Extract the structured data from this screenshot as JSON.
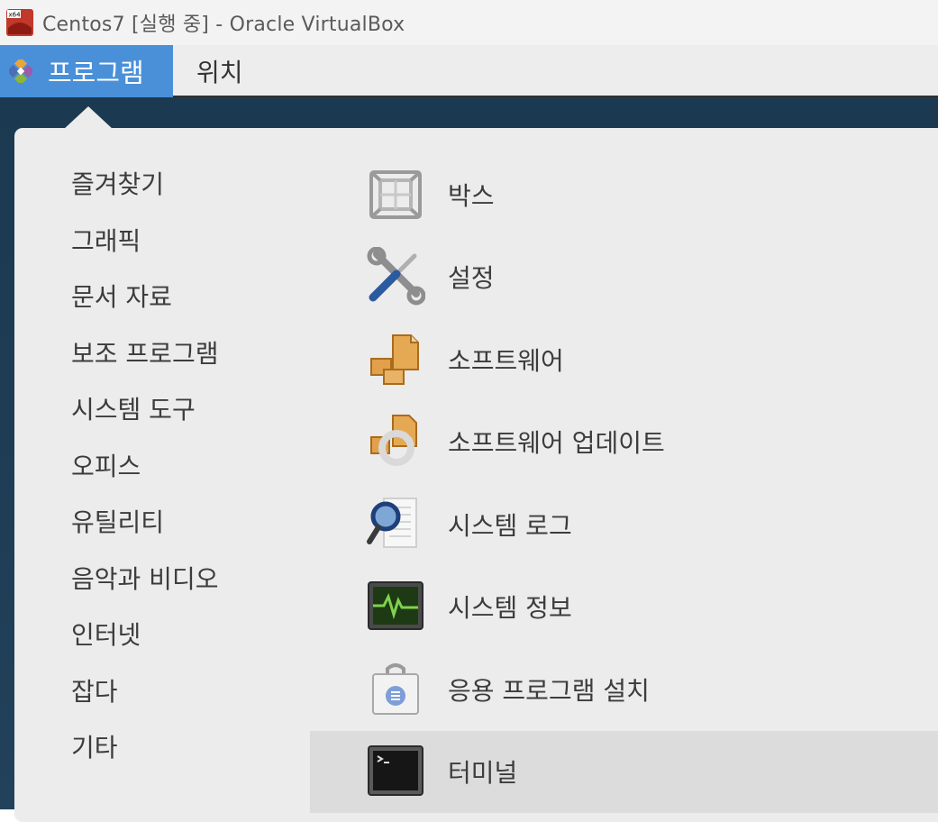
{
  "window": {
    "title": "Centos7 [실행 중] - Oracle VirtualBox",
    "icon": "virtualbox-x64-icon"
  },
  "topbar": {
    "applications_label": "프로그램",
    "places_label": "위치",
    "accent_color": "#4a90d9"
  },
  "categories": [
    {
      "label": "즐겨찾기"
    },
    {
      "label": "그래픽"
    },
    {
      "label": "문서 자료"
    },
    {
      "label": "보조 프로그램"
    },
    {
      "label": "시스템 도구"
    },
    {
      "label": "오피스"
    },
    {
      "label": "유틸리티"
    },
    {
      "label": "음악과 비디오"
    },
    {
      "label": "인터넷"
    },
    {
      "label": "잡다"
    },
    {
      "label": "기타"
    }
  ],
  "apps": [
    {
      "label": "박스",
      "icon": "boxes-icon"
    },
    {
      "label": "설정",
      "icon": "settings-tools-icon"
    },
    {
      "label": "소프트웨어",
      "icon": "software-packages-icon"
    },
    {
      "label": "소프트웨어 업데이트",
      "icon": "software-update-icon"
    },
    {
      "label": "시스템 로그",
      "icon": "log-magnifier-icon"
    },
    {
      "label": "시스템 정보",
      "icon": "system-monitor-icon"
    },
    {
      "label": "응용 프로그램 설치",
      "icon": "app-installer-bag-icon"
    },
    {
      "label": "터미널",
      "icon": "terminal-icon",
      "highlighted": true
    }
  ]
}
